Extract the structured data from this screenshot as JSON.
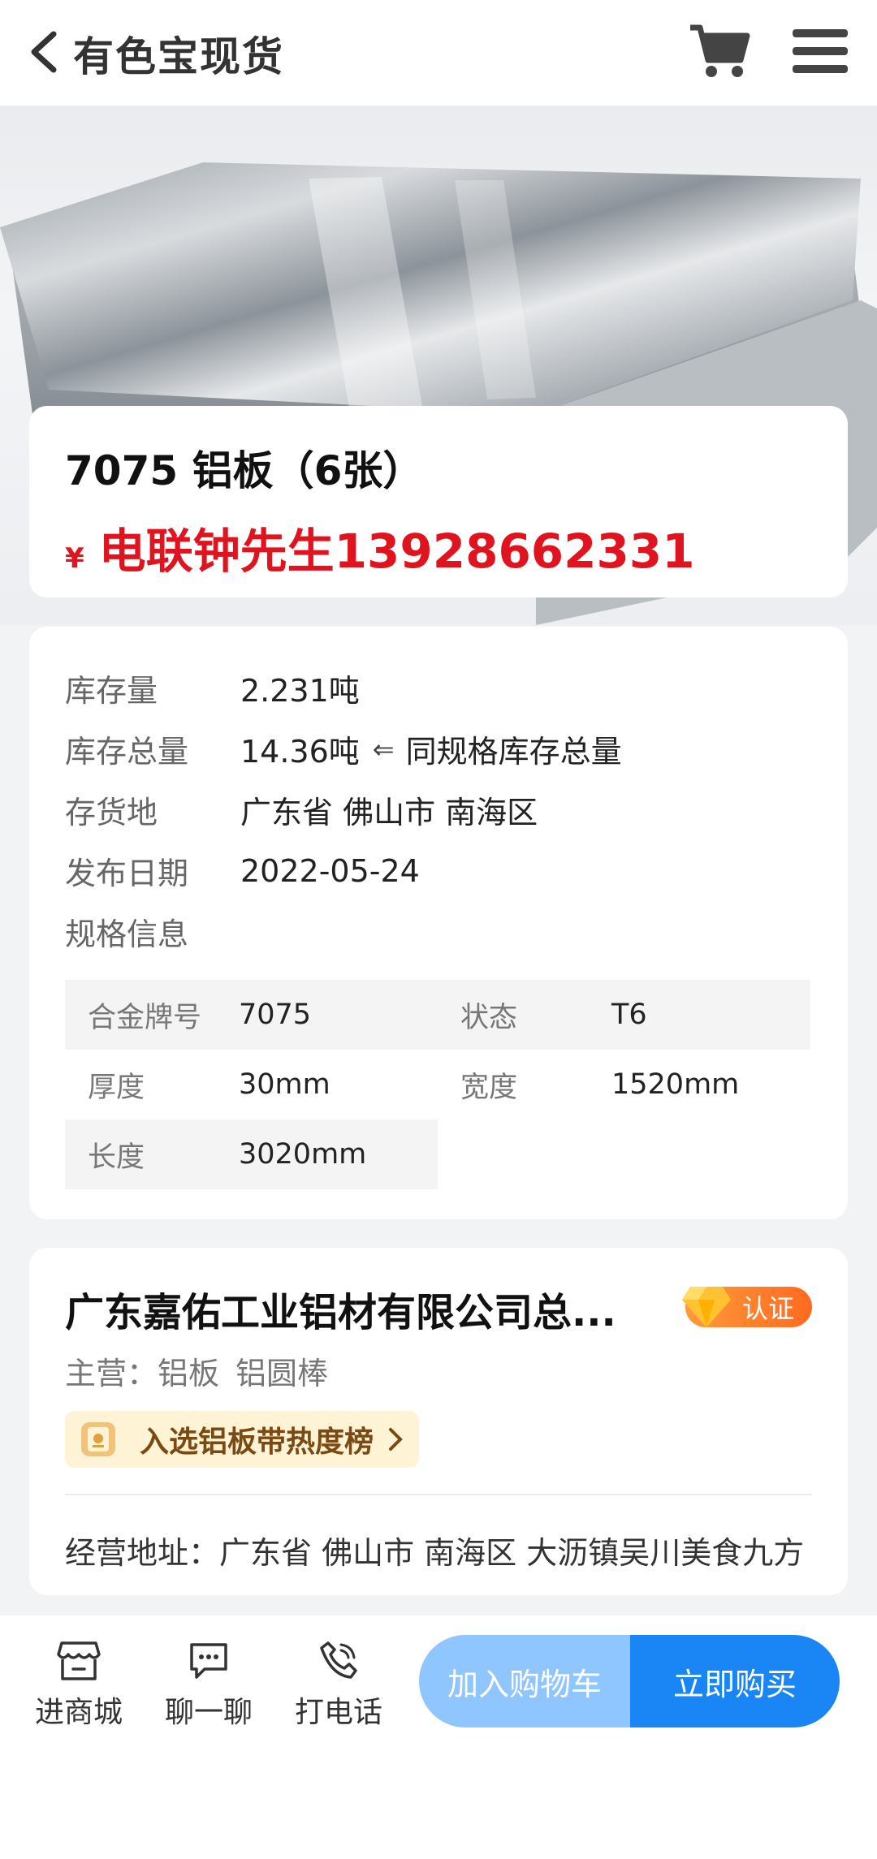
{
  "header": {
    "title": "有色宝现货"
  },
  "product": {
    "title": "7075 铝板（6张）",
    "currency": "¥",
    "price_text": "电联钟先生13928662331"
  },
  "info": {
    "rows": [
      {
        "label": "库存量",
        "value": "2.231吨"
      },
      {
        "label": "库存总量",
        "value": "14.36吨",
        "arrow": "⇐",
        "note": "同规格库存总量"
      },
      {
        "label": "存货地",
        "value": "广东省 佛山市 南海区"
      },
      {
        "label": "发布日期",
        "value": "2022-05-24"
      },
      {
        "label": "规格信息",
        "value": ""
      }
    ],
    "specs": [
      {
        "key": "合金牌号",
        "value": "7075"
      },
      {
        "key": "状态",
        "value": "T6"
      },
      {
        "key": "厚度",
        "value": "30mm"
      },
      {
        "key": "宽度",
        "value": "1520mm"
      },
      {
        "key": "长度",
        "value": "3020mm"
      }
    ]
  },
  "company": {
    "name": "广东嘉佑工业铝材有限公司总...",
    "cert_label": "认证",
    "main_biz_label": "主营：",
    "main_biz": [
      "铝板",
      "铝圆棒"
    ],
    "rank_text": "入选铝板带热度榜",
    "address": "经营地址：广东省 佛山市 南海区 大沥镇吴川美食九方"
  },
  "bottom_bar": {
    "store_label": "进商城",
    "chat_label": "聊一聊",
    "call_label": "打电话",
    "add_cart_label": "加入购物车",
    "buy_label": "立即购买"
  },
  "colors": {
    "price_red": "#e0141e",
    "accent_blue": "#1a86f5",
    "light_blue": "#8fc6ff",
    "badge_orange": "#ff6a1f"
  }
}
